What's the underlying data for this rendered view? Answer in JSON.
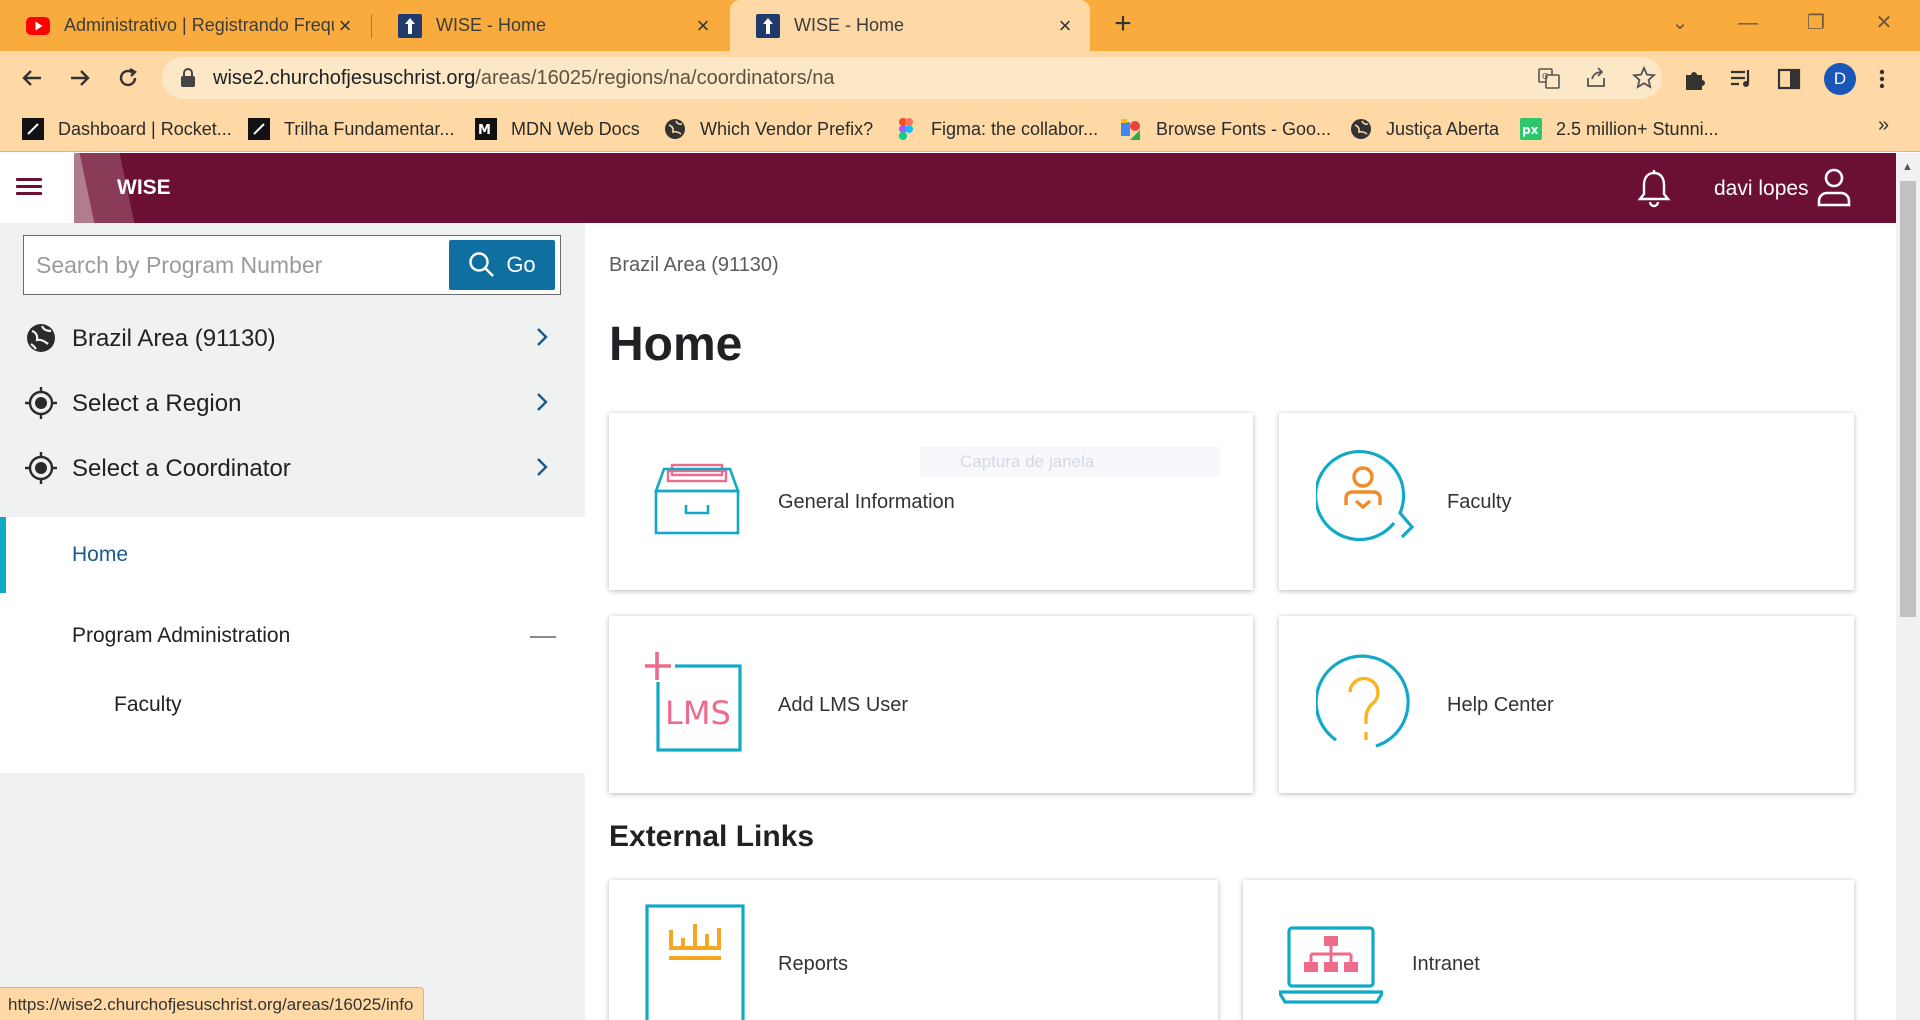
{
  "browser": {
    "tabs": [
      {
        "title": "Administrativo | Registrando Frequ",
        "icon": "youtube-icon",
        "active": false
      },
      {
        "title": "WISE - Home",
        "icon": "wise-favicon-icon",
        "active": false
      },
      {
        "title": "WISE - Home",
        "icon": "wise-favicon-icon",
        "active": true
      }
    ],
    "url_host": "wise2.churchofjesuschrist.org",
    "url_path": "/areas/16025/regions/na/coordinators/na",
    "profile_initial": "D",
    "bookmarks": [
      {
        "label": "Dashboard | Rocket...",
        "icon": "rocketseat-icon"
      },
      {
        "label": "Trilha Fundamentar...",
        "icon": "rocketseat-icon"
      },
      {
        "label": "MDN Web Docs",
        "icon": "mdn-icon"
      },
      {
        "label": "Which Vendor Prefix?",
        "icon": "globe-icon"
      },
      {
        "label": "Figma: the collabor...",
        "icon": "figma-icon"
      },
      {
        "label": "Browse Fonts - Goo...",
        "icon": "google-fonts-icon"
      },
      {
        "label": "Justiça Aberta",
        "icon": "globe-icon"
      },
      {
        "label": "2.5 million+ Stunni...",
        "icon": "pixabay-icon"
      }
    ],
    "more_bookmarks": "»",
    "status_url": "https://wise2.churchofjesuschrist.org/areas/16025/info"
  },
  "header": {
    "brand": "WISE",
    "username": "davi lopes"
  },
  "sidebar": {
    "search_placeholder": "Search by Program Number",
    "go_label": "Go",
    "selectors": [
      {
        "label": "Brazil Area (91130)",
        "icon": "globe-icon"
      },
      {
        "label": "Select a Region",
        "icon": "target-icon"
      },
      {
        "label": "Select a Coordinator",
        "icon": "target-icon"
      }
    ],
    "nav": {
      "home": "Home",
      "program_admin": "Program Administration",
      "faculty": "Faculty"
    }
  },
  "main": {
    "breadcrumb": "Brazil Area (91130)",
    "title": "Home",
    "cards": [
      {
        "label": "General Information",
        "icon": "file-box-icon"
      },
      {
        "label": "Faculty",
        "icon": "faculty-search-icon"
      },
      {
        "label": "Add LMS User",
        "icon": "lms-add-icon"
      },
      {
        "label": "Help Center",
        "icon": "help-question-icon"
      }
    ],
    "external_title": "External Links",
    "external_cards": [
      {
        "label": "Reports",
        "icon": "reports-icon"
      },
      {
        "label": "Intranet",
        "icon": "intranet-laptop-icon"
      }
    ],
    "ghost_text": "Captura de janela"
  },
  "colors": {
    "tab_strip": "#f9ab3d",
    "toolbar": "#fed9a5",
    "app_header": "#6c0f34",
    "go_button": "#0e6fa0",
    "accent_cyan": "#12a9c7",
    "accent_pink": "#ee6b8b",
    "accent_orange": "#f5a623"
  }
}
